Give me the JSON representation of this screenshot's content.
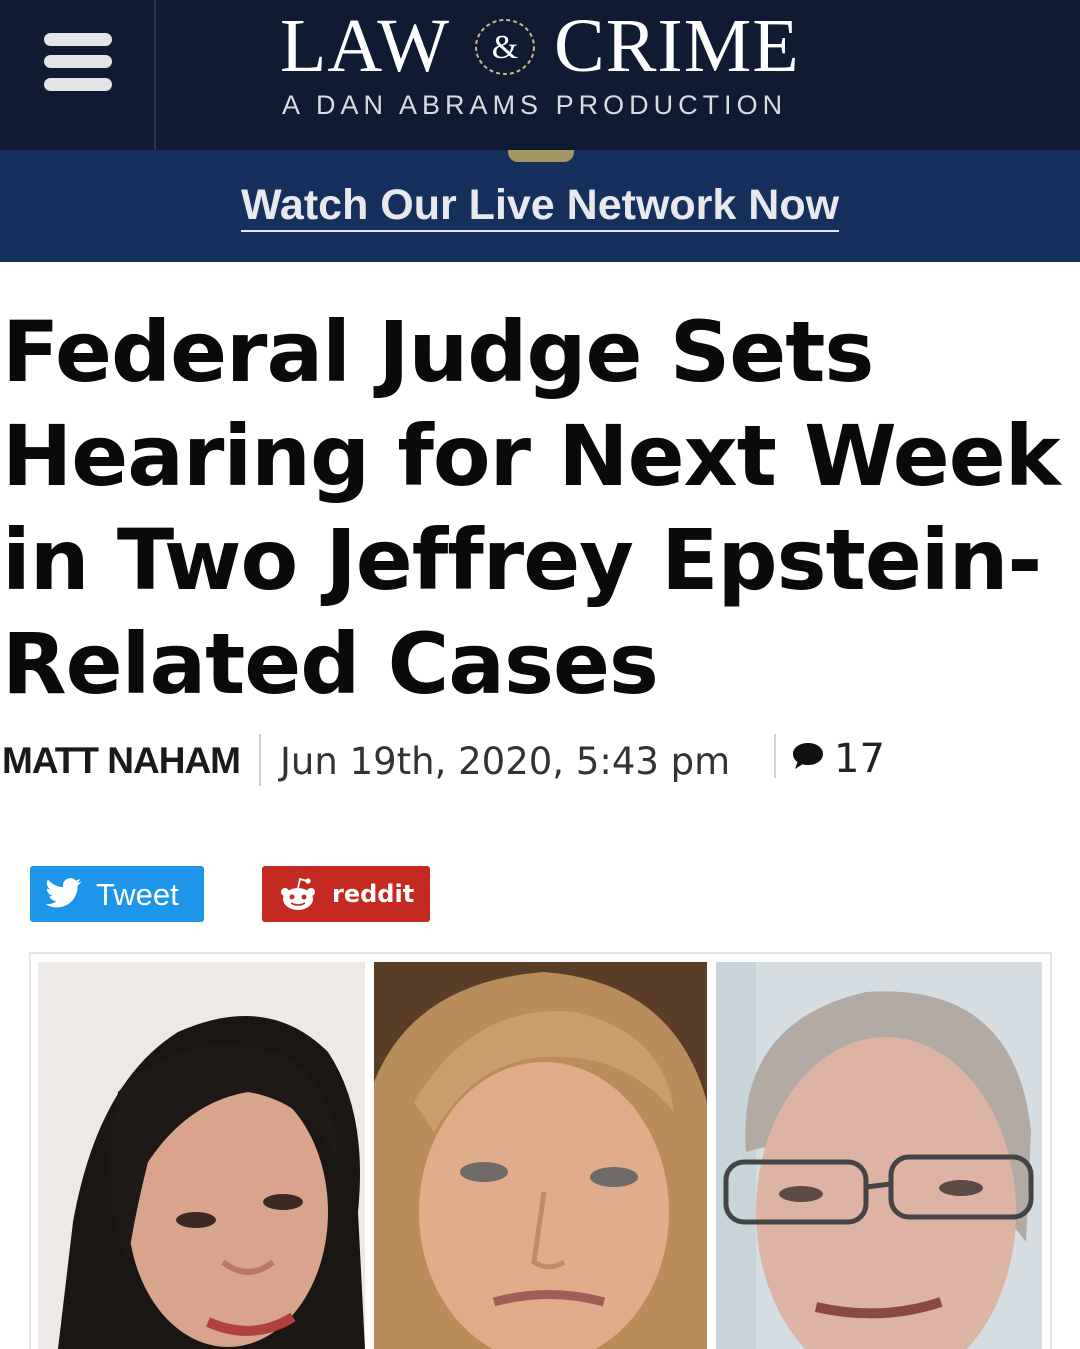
{
  "header": {
    "logo_left": "LAW",
    "logo_amp": "&",
    "logo_right": "CRIME",
    "tagline": "A DAN ABRAMS PRODUCTION",
    "menu_icon": "hamburger-menu-icon"
  },
  "live_banner": {
    "link_text": "Watch Our Live Network Now"
  },
  "article": {
    "headline": "Federal Judge Sets Hearing for Next Week in Two Jeffrey Epstein-Related Cases",
    "author": "MATT NAHAM",
    "date": "Jun 19th, 2020, 5:43 pm",
    "comment_count": "17"
  },
  "share": {
    "tweet_label": "Tweet",
    "reddit_label": "reddit"
  },
  "colors": {
    "header_bg": "#101a33",
    "banner_bg": "#15305c",
    "twitter_blue": "#1d95e8",
    "reddit_red": "#c52a22"
  }
}
